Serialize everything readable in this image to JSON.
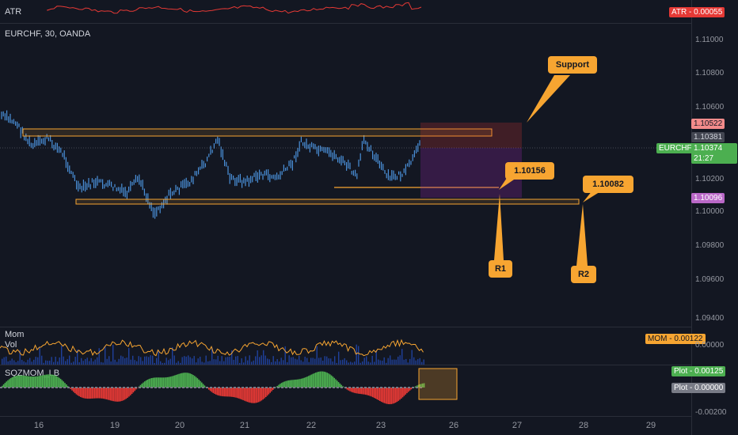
{
  "atr": {
    "label": "ATR",
    "badge_name": "ATR",
    "badge_value": "0.00055",
    "color": "#e53935"
  },
  "main": {
    "title": "EURCHF, 30, OANDA",
    "yticks": [
      "1.11000",
      "1.10800",
      "1.10600",
      "1.10200",
      "1.10000",
      "1.09800",
      "1.09600",
      "1.09400"
    ],
    "price_badges": {
      "top": "1.10522",
      "mid": "1.10381",
      "last_symbol": "EURCHF",
      "last_value": "1.10374",
      "countdown": "21:27",
      "bottom": "1.10096"
    },
    "callouts": {
      "support": "Support",
      "r1_price": "1.10156",
      "r2_price": "1.10082",
      "r1": "R1",
      "r2": "R2"
    }
  },
  "mom": {
    "label_mom": "Mom",
    "label_vol": "Vol",
    "badge_name": "MOM",
    "badge_value": "0.00122",
    "zero_tick": "0.00000"
  },
  "sqz": {
    "label": "SQZMOM_LB",
    "plot1_name": "Plot",
    "plot1_value": "0.00125",
    "plot2_name": "Plot",
    "plot2_value": "0.00000",
    "neg_tick": "-0.00200"
  },
  "xaxis": {
    "ticks": [
      "16",
      "19",
      "20",
      "21",
      "22",
      "23",
      "26",
      "27",
      "28",
      "29"
    ]
  },
  "colors": {
    "candle": "#4a90d9",
    "zone": "#f7a531",
    "green": "#4caf50",
    "red": "#e53935",
    "purple": "#ba68c8"
  }
}
